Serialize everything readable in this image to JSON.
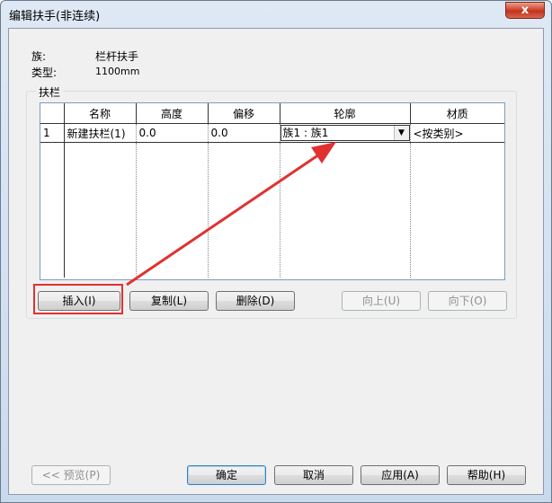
{
  "window": {
    "title": "编辑扶手(非连续)",
    "close_label": "x"
  },
  "info": {
    "family_label": "族:",
    "family_value": "栏杆扶手",
    "type_label": "类型:",
    "type_value": "1100mm"
  },
  "group": {
    "title": "扶栏"
  },
  "grid": {
    "columns": [
      "",
      "名称",
      "高度",
      "偏移",
      "轮廓",
      "材质"
    ],
    "rows": [
      {
        "index": "1",
        "name": "新建扶栏(1)",
        "height": "0.0",
        "offset": "0.0",
        "profile": "族1 : 族1",
        "material": "<按类别>"
      }
    ]
  },
  "row_buttons": {
    "insert": "插入(I)",
    "copy": "复制(L)",
    "delete": "删除(D)",
    "up": "向上(U)",
    "down": "向下(O)"
  },
  "footer": {
    "preview": "<< 预览(P)",
    "ok": "确定",
    "cancel": "取消",
    "apply": "应用(A)",
    "help": "帮助(H)"
  },
  "annotation": {
    "color": "#e03131"
  }
}
